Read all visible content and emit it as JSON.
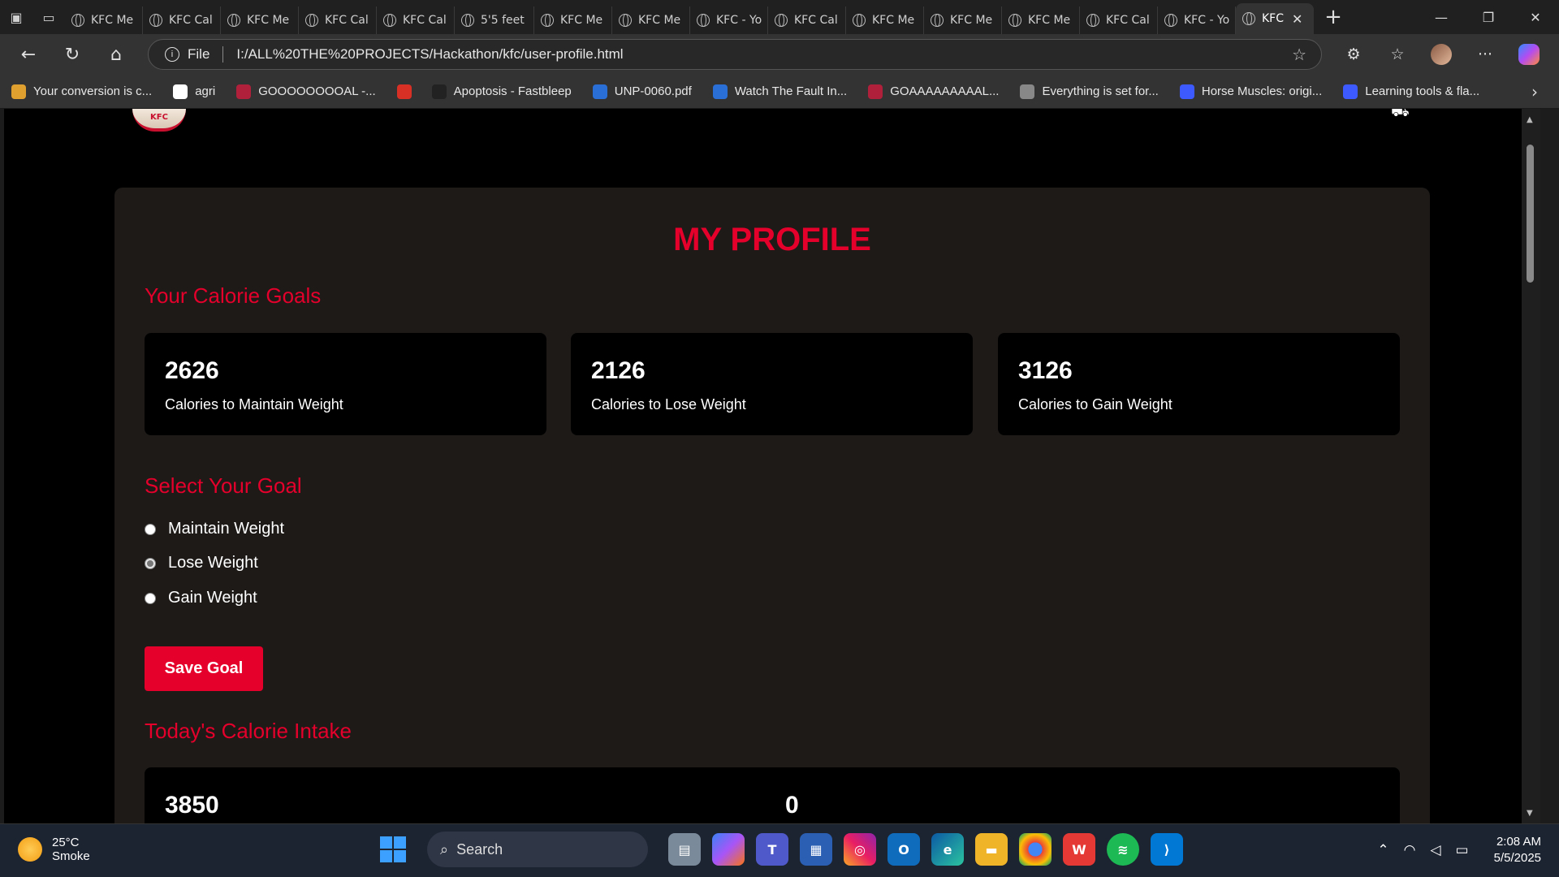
{
  "browser": {
    "tabs": [
      {
        "label": "KFC Me",
        "active": false
      },
      {
        "label": "KFC Cal",
        "active": false
      },
      {
        "label": "KFC Me",
        "active": false
      },
      {
        "label": "KFC Cal",
        "active": false
      },
      {
        "label": "KFC Cal",
        "active": false
      },
      {
        "label": "5'5 feet",
        "active": false
      },
      {
        "label": "KFC Me",
        "active": false
      },
      {
        "label": "KFC Me",
        "active": false
      },
      {
        "label": "KFC - Yo",
        "active": false
      },
      {
        "label": "KFC Cal",
        "active": false
      },
      {
        "label": "KFC Me",
        "active": false
      },
      {
        "label": "KFC Me",
        "active": false
      },
      {
        "label": "KFC Me",
        "active": false
      },
      {
        "label": "KFC Cal",
        "active": false
      },
      {
        "label": "KFC - Yo",
        "active": false
      },
      {
        "label": "KFC",
        "active": true
      }
    ],
    "address": {
      "scheme_label": "File",
      "url": "I:/ALL%20THE%20PROJECTS/Hackathon/kfc/user-profile.html"
    },
    "bookmarks": [
      {
        "label": "Your conversion is c...",
        "color": "#e0a030"
      },
      {
        "label": "agri",
        "color": "#ffffff"
      },
      {
        "label": "GOOOOOOOOAL -...",
        "color": "#b0203a"
      },
      {
        "label": "",
        "color": "#d93025"
      },
      {
        "label": "Apoptosis - Fastbleep",
        "color": "#222222"
      },
      {
        "label": "UNP-0060.pdf",
        "color": "#2a6fd6"
      },
      {
        "label": "Watch The Fault In...",
        "color": "#2a6fd6"
      },
      {
        "label": "GOAAAAAAAAAL...",
        "color": "#b0203a"
      },
      {
        "label": "Everything is set for...",
        "color": "#888888"
      },
      {
        "label": "Horse Muscles: origi...",
        "color": "#3d5afe"
      },
      {
        "label": "Learning tools & fla...",
        "color": "#3d5afe"
      }
    ]
  },
  "page": {
    "logo_text": "KFC",
    "title": "MY PROFILE",
    "goals_heading": "Your Calorie Goals",
    "goals": [
      {
        "value": "2626",
        "label": "Calories to Maintain Weight"
      },
      {
        "value": "2126",
        "label": "Calories to Lose Weight"
      },
      {
        "value": "3126",
        "label": "Calories to Gain Weight"
      }
    ],
    "select_heading": "Select Your Goal",
    "options": [
      {
        "label": "Maintain Weight",
        "checked": false
      },
      {
        "label": "Lose Weight",
        "checked": true
      },
      {
        "label": "Gain Weight",
        "checked": false
      }
    ],
    "save_label": "Save Goal",
    "intake_heading": "Today's Calorie Intake",
    "intake_values": [
      "3850",
      "0"
    ],
    "accent_color": "#e4002b"
  },
  "taskbar": {
    "weather": {
      "temp": "25°C",
      "condition": "Smoke"
    },
    "search_label": "Search",
    "time": "2:08 AM",
    "date": "5/5/2025"
  }
}
